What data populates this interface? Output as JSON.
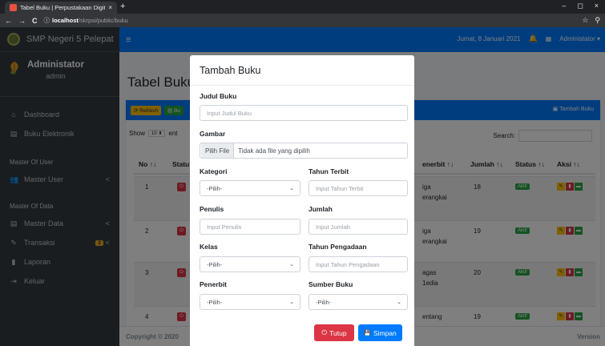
{
  "browser": {
    "tab_title": "Tabel Buku | Perpustakaan Digital",
    "tab_close": "×",
    "new_tab": "+",
    "url_host": "localhost",
    "url_path": "/skrpsi/public/buku",
    "nav_back": "←",
    "nav_forward": "→",
    "nav_reload": "C",
    "info_icon": "ⓘ",
    "star": "☆",
    "extension": "⚲",
    "minimize": "–",
    "maximize": "◻",
    "close": "×"
  },
  "sidebar": {
    "brand": "SMP Negeri 5 Pelepat",
    "user_name": "Administator",
    "user_role": "admin",
    "items": [
      {
        "icon": "⌂",
        "label": "Dashboard"
      },
      {
        "icon": "▤",
        "label": "Buku Elektronik"
      }
    ],
    "section_user": "Master Of User",
    "master_user": {
      "icon": "👥",
      "label": "Master User",
      "arrow": "<"
    },
    "section_data": "Master Of Data",
    "master_data": {
      "icon": "▤",
      "label": "Master Data",
      "arrow": "<"
    },
    "transaksi": {
      "icon": "✎",
      "label": "Transaksi",
      "badge": "2",
      "arrow": "<"
    },
    "laporan": {
      "icon": "▮",
      "label": "Laporan"
    },
    "keluar": {
      "icon": "⇥",
      "label": "Keluar"
    }
  },
  "topnav": {
    "hamburger": "≡",
    "date": "Jumat, 8 Januari 2021",
    "notif_icon": "🔔",
    "admin": "Administator ▾",
    "grid_icon": "▦"
  },
  "content": {
    "page_title": "Tabel Buku",
    "refresh": "⟳ Refresh",
    "buku": "▤ Bu",
    "tambah": "▣ Tambah Buku",
    "show": "Show",
    "show_value": "10 ⬍",
    "entries": "ent",
    "search": "Search:",
    "headers": {
      "no": "No ↑↓",
      "status_short": "Statu",
      "penerbit": "enerbit ↑↓",
      "jumlah": "Jumlah ↑↓",
      "status": "Status ↑↓",
      "aksi": "Aksi ↑↓"
    },
    "rows": [
      {
        "no": "1",
        "penerbit": "iga",
        "penerbit2": "erangkai",
        "jumlah": "18",
        "status": "Aktif"
      },
      {
        "no": "2",
        "penerbit": "iga",
        "penerbit2": "erangkai",
        "jumlah": "19",
        "status": "Aktif"
      },
      {
        "no": "3",
        "penerbit": "agas",
        "penerbit2": "1edia",
        "jumlah": "20",
        "status": "Aktif"
      },
      {
        "no": "4",
        "penerbit": "entang",
        "penerbit2": "",
        "jumlah": "19",
        "status": "Aktif"
      }
    ],
    "footer_left": "Copyright © 2020",
    "footer_right": "Version"
  },
  "modal": {
    "title": "Tambah Buku",
    "judul_label": "Judul Buku",
    "judul_ph": "Input Judul Buku",
    "gambar_label": "Gambar",
    "file_btn": "Pilih File",
    "file_text": "Tidak ada file yang dipilih",
    "kategori_label": "Kategori",
    "kategori_value": "-Pilih-",
    "tahun_terbit_label": "Tahun Terbit",
    "tahun_terbit_ph": "Input Tahun Terbit",
    "penulis_label": "Penulis",
    "penulis_ph": "Input Penulis",
    "jumlah_label": "Jumlah",
    "jumlah_ph": "Input Jumlah",
    "kelas_label": "Kelas",
    "kelas_value": "-Pilih-",
    "tahun_pengadaan_label": "Tahun Pengadaan",
    "tahun_pengadaan_ph": "Input Tahun Pengadaan",
    "penerbit_label": "Penerbit",
    "penerbit_value": "-Pilih-",
    "sumber_label": "Sumber Buku",
    "sumber_value": "-Pilih-",
    "caret": "⌄",
    "tutup": "Tutup",
    "simpan": "Simpan",
    "tutup_icon": "⏻",
    "simpan_icon": "💾"
  },
  "colors": {
    "primary": "#007bff",
    "danger": "#dc3545",
    "success": "#28a745",
    "warning": "#ffc107",
    "sidebar": "#343a40"
  }
}
